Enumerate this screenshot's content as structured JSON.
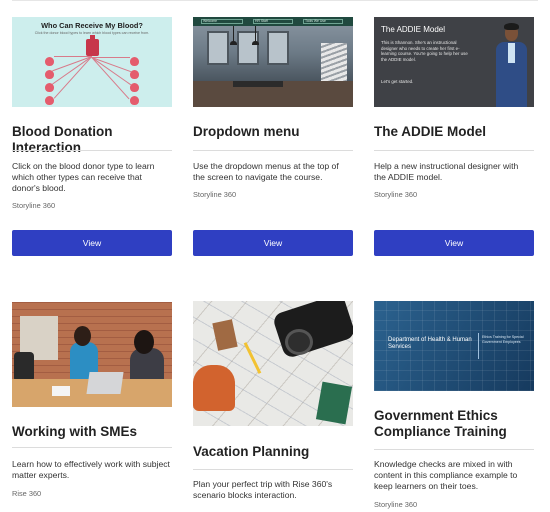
{
  "cards": [
    {
      "title": "Blood Donation Interaction",
      "description": "Click on the blood donor type to learn which other types can receive that donor's blood.",
      "product": "Storyline 360",
      "button": "View",
      "thumb": {
        "heading": "Who Can Receive My Blood?",
        "subtext": "Click the donor blood types to learn which blood types can receive from."
      }
    },
    {
      "title": "Dropdown menu",
      "description": "Use the dropdown menus at the top of the screen to navigate the course.",
      "product": "Storyline 360",
      "button": "View",
      "thumb": {
        "menus": [
          "Welcome",
          "HR Staff",
          "Tools We Use"
        ]
      }
    },
    {
      "title": "The ADDIE Model",
      "description": "Help a new instructional designer with the ADDIE model.",
      "product": "Storyline 360",
      "button": "View",
      "thumb": {
        "heading": "The ADDIE Model",
        "body": "This is Shannon. She's an instructional designer who needs to create her first e-learning course. You're going to help her use the ADDIE model.",
        "cta": "Let's get started."
      }
    },
    {
      "title": "Working with SMEs",
      "description": "Learn how to effectively work with subject matter experts.",
      "product": "Rise 360"
    },
    {
      "title": "Vacation Planning",
      "description": "Plan your perfect trip with Rise 360's scenario blocks interaction."
    },
    {
      "title": "Government Ethics Compliance Training",
      "description": "Knowledge checks are mixed in with content in this compliance example to keep learners on their toes.",
      "product": "Storyline 360",
      "thumb": {
        "dept": "Department of Health & Human Services",
        "training": "Ethics Training for Special Government Employees"
      }
    }
  ],
  "colors": {
    "button_bg": "#2f3fc2",
    "button_text": "#ffffff"
  }
}
